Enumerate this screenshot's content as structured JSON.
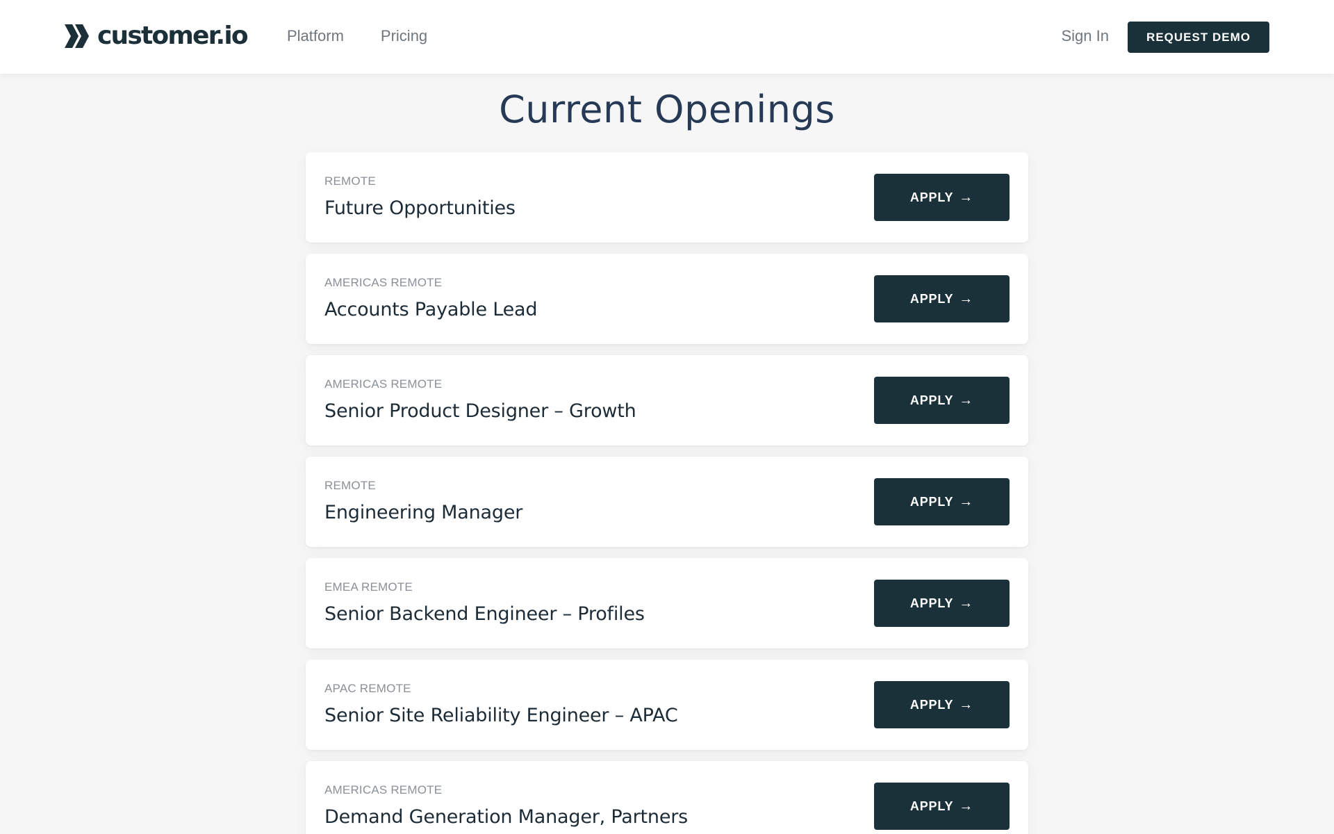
{
  "header": {
    "logo_text": "customer.io",
    "nav": [
      {
        "label": "Platform"
      },
      {
        "label": "Pricing"
      }
    ],
    "sign_in_label": "Sign In",
    "demo_label": "REQUEST DEMO"
  },
  "main": {
    "title": "Current Openings",
    "apply_label": "APPLY",
    "arrow_glyph": "→",
    "jobs": [
      {
        "location": "REMOTE",
        "title": "Future Opportunities"
      },
      {
        "location": "AMERICAS REMOTE",
        "title": "Accounts Payable Lead"
      },
      {
        "location": "AMERICAS REMOTE",
        "title": "Senior Product Designer – Growth"
      },
      {
        "location": "REMOTE",
        "title": "Engineering Manager"
      },
      {
        "location": "EMEA REMOTE",
        "title": "Senior Backend Engineer – Profiles"
      },
      {
        "location": "APAC REMOTE",
        "title": "Senior Site Reliability Engineer – APAC"
      },
      {
        "location": "AMERICAS REMOTE",
        "title": "Demand Generation Manager, Partners"
      }
    ]
  },
  "icons": {
    "logo_mark": "chevrons-logo-icon",
    "apply_arrow": "arrow-right-icon"
  },
  "colors": {
    "primary_dark": "#1a3139",
    "title_navy": "#263a55",
    "muted_gray": "#8a9096",
    "page_bg": "#f6f6f7"
  }
}
